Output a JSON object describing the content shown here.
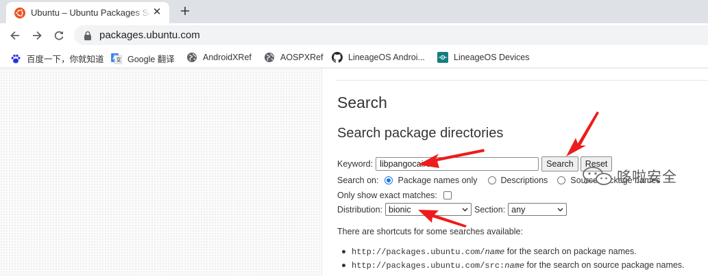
{
  "browser": {
    "tab_title": "Ubuntu – Ubuntu Packages Search",
    "url": "packages.ubuntu.com",
    "close_glyph": "✕"
  },
  "bookmarks": [
    {
      "label": "百度一下，你就知道",
      "icon": "baidu-paw-icon"
    },
    {
      "label": "Google 翻译",
      "icon": "google-translate-icon"
    },
    {
      "label": "AndroidXRef",
      "icon": "globe-icon"
    },
    {
      "label": "AOSPXRef",
      "icon": "globe-icon"
    },
    {
      "label": "LineageOS Androi...",
      "icon": "github-icon"
    },
    {
      "label": "LineageOS Devices",
      "icon": "lineageos-icon"
    }
  ],
  "page": {
    "title": "Search",
    "subtitle": "Search package directories",
    "keyword_label": "Keyword:",
    "keyword_value": "libpangocairo",
    "search_button": "Search",
    "reset_button": "Reset",
    "search_on_label": "Search on:",
    "search_on_options": [
      "Package names only",
      "Descriptions",
      "Source package names"
    ],
    "search_on_selected": "Package names only",
    "exact_label": "Only show exact matches:",
    "exact_checked": false,
    "distribution_label": "Distribution:",
    "distribution_value": "bionic",
    "section_label": "Section:",
    "section_value": "any",
    "shortcuts_intro": "There are shortcuts for some searches available:",
    "shortcuts": [
      {
        "url": "http://packages.ubuntu.com/",
        "var": "name",
        "text": " for the search on package names."
      },
      {
        "url": "http://packages.ubuntu.com/src:",
        "var": "name",
        "text": " for the search on source package names."
      }
    ]
  },
  "watermark": "哆啦安全",
  "annotation_color": "#ee1c1c",
  "colors": {
    "tabstrip": "#dee1e6",
    "omnibox": "#f1f3f4",
    "radio_accent": "#1a73e8",
    "ubuntu_orange": "#e95420"
  }
}
